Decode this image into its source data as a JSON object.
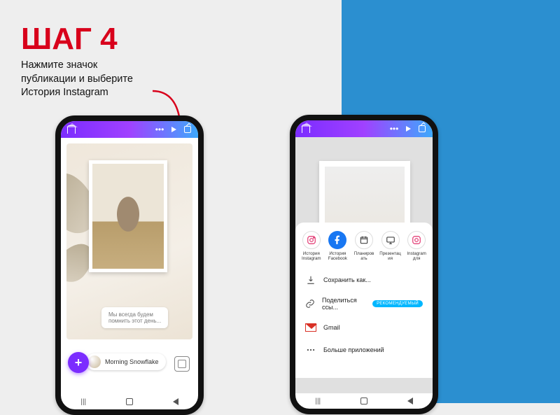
{
  "heading": {
    "step": "ШАГ 4",
    "desc_line1": "Нажмите значок",
    "desc_line2": "публикации и выберите",
    "desc_line3": "История Instagram"
  },
  "toolbar": {
    "more": "•••"
  },
  "story": {
    "caption_line1": "Мы всегда будем",
    "caption_line2": "помнить этот день...",
    "author": "Morning Snowflake",
    "fab": "+"
  },
  "share": {
    "targets": [
      {
        "name": "История Instagram"
      },
      {
        "name": "История Facebook"
      },
      {
        "name": "Планиров ать"
      },
      {
        "name": "Презентац ия"
      },
      {
        "name": "Instagram для"
      }
    ],
    "save_as": "Сохранить как...",
    "share_link": "Поделиться ссы...",
    "badge": "РЕКОМЕНДУЕМЫЙ",
    "gmail": "Gmail",
    "more_apps": "Больше приложений"
  },
  "nav": {
    "recents": "|||"
  }
}
